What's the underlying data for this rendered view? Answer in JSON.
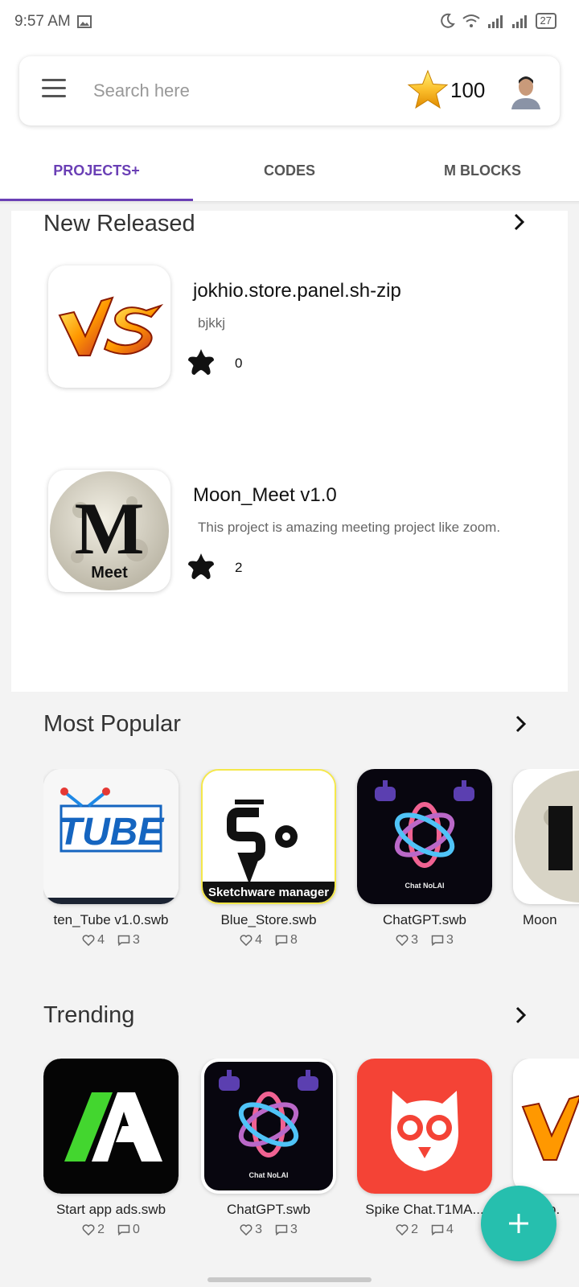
{
  "status_bar": {
    "time": "9:57 AM",
    "battery": "27",
    "icons": [
      "gallery-icon",
      "moon-icon",
      "wifi-icon",
      "signal-icon",
      "signal-icon",
      "battery-icon"
    ]
  },
  "search": {
    "placeholder": "Search here",
    "coins": "100"
  },
  "tabs": [
    {
      "label": "PROJECTS+",
      "active": true
    },
    {
      "label": "CODES",
      "active": false
    },
    {
      "label": "M BLOCKS",
      "active": false
    }
  ],
  "new_released": {
    "title": "New Released",
    "items": [
      {
        "name": "jokhio.store.panel.sh-zip",
        "description": "bjkkj",
        "stars": "0",
        "icon": "vs-logo"
      },
      {
        "name": "Moon_Meet v1.0",
        "description": "This project is amazing meeting project like zoom.",
        "stars": "2",
        "icon": "moon-meet-logo"
      }
    ]
  },
  "most_popular": {
    "title": "Most Popular",
    "items": [
      {
        "name": "ten_Tube v1.0.swb",
        "likes": "4",
        "comments": "3",
        "icon": "tube-logo"
      },
      {
        "name": "Blue_Store.swb",
        "likes": "4",
        "comments": "8",
        "icon": "sketchware-manager-logo"
      },
      {
        "name": "ChatGPT.swb",
        "likes": "3",
        "comments": "3",
        "icon": "chatgpt-logo"
      },
      {
        "name": "Moon",
        "likes": "",
        "comments": "",
        "icon": "moon-meet-logo"
      }
    ]
  },
  "trending": {
    "title": "Trending",
    "items": [
      {
        "name": "Start app ads.swb",
        "likes": "2",
        "comments": "0",
        "icon": "startapp-logo"
      },
      {
        "name": "ChatGPT.swb",
        "likes": "3",
        "comments": "3",
        "icon": "chatgpt-logo"
      },
      {
        "name": "Spike Chat.T1MA...",
        "likes": "2",
        "comments": "4",
        "icon": "owl-logo"
      },
      {
        "name": "o.",
        "likes": "",
        "comments": "",
        "icon": "vs-logo"
      }
    ]
  },
  "logo_text": {
    "tube": "TUBE",
    "sketchware": "Sketchware manager",
    "chatgpt_caption": "Chat NoLAI",
    "meet": "Meet",
    "moon_letter": "M"
  },
  "colors": {
    "accent": "#6a3fb5",
    "fab": "#26bfae",
    "owl_red": "#f44336",
    "startapp_green": "#43d62f"
  }
}
